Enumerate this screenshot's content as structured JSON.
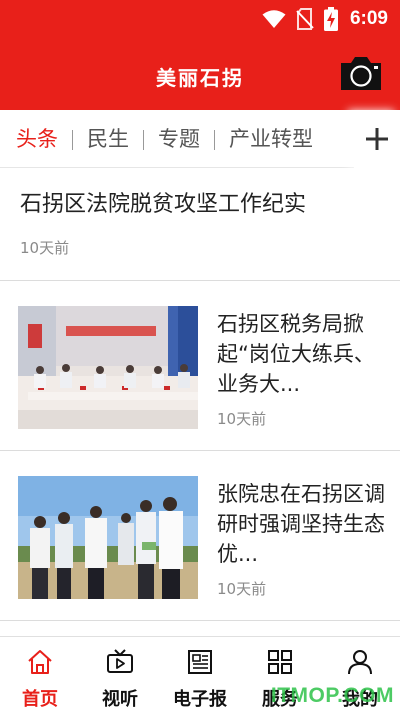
{
  "status": {
    "time": "6:09"
  },
  "header": {
    "title": "美丽石拐"
  },
  "tabs": [
    {
      "label": "头条",
      "active": true
    },
    {
      "label": "民生",
      "active": false
    },
    {
      "label": "专题",
      "active": false
    },
    {
      "label": "产业转型",
      "active": false
    }
  ],
  "feed": [
    {
      "title": "石拐区法院脱贫攻坚工作纪实",
      "time": "10天前"
    },
    {
      "title": "石拐区税务局掀起“岗位大练兵、业务大...",
      "time": "10天前"
    },
    {
      "title": "张院忠在石拐区调研时强调坚持生态优...",
      "time": "10天前"
    }
  ],
  "bottom_nav": [
    {
      "label": "首页",
      "icon": "home-icon",
      "active": true
    },
    {
      "label": "视听",
      "icon": "tv-icon",
      "active": false
    },
    {
      "label": "电子报",
      "icon": "newspaper-icon",
      "active": false
    },
    {
      "label": "服务",
      "icon": "grid-icon",
      "active": false
    },
    {
      "label": "我的",
      "icon": "user-icon",
      "active": false
    }
  ],
  "watermark": "ITMOP.COM",
  "colors": {
    "brand": "#e8201a",
    "watermark": "#2ec24a"
  }
}
